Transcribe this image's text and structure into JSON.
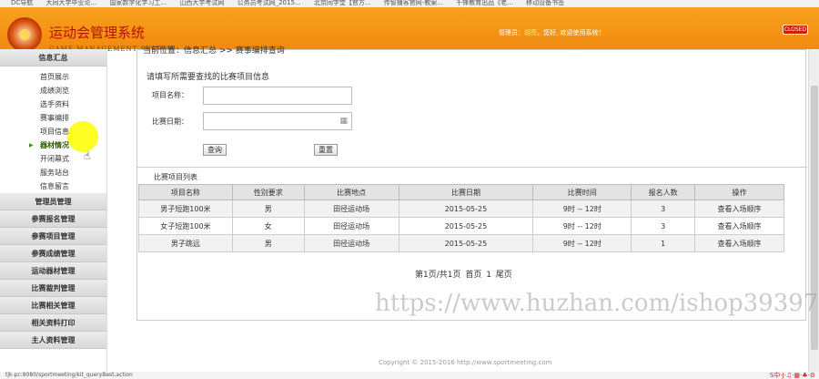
{
  "browser": {
    "bookmarks": [
      "DC导航",
      "大同大学毕业论...",
      "国家数字化学习工...",
      "山西大学考试网",
      "公务员考试网_2015...",
      "北京同学堂【官方...",
      "传智播客官网-教案...",
      "千锋教育出品《老...",
      "移动设备书签"
    ],
    "status_url": "tjk-pc:8080/sportmeeting/kit_queryBest.action"
  },
  "header": {
    "title": "运动会管理系统",
    "subtitle": "GAME MANAGEMENT SYSTEM",
    "welcome_prefix": "管理员：",
    "user_name": "胡亮",
    "welcome_suffix": "，您好, 欢迎使用系统！",
    "close_label": "CLOSED"
  },
  "sidebar": {
    "group_main": "信息汇总",
    "items": [
      "首页展示",
      "成绩浏览",
      "选手资料",
      "赛事编排",
      "项目信息",
      "器材情况",
      "开闭幕式",
      "服务站台",
      "信息留言"
    ],
    "active_index": 5,
    "groups": [
      "管理员管理",
      "参赛报名管理",
      "参赛项目管理",
      "参赛成绩管理",
      "运动器材管理",
      "比赛裁判管理",
      "比赛相关管理",
      "相关资料打印",
      "主人资料管理"
    ]
  },
  "main": {
    "breadcrumb": "当前位置：信息汇总 >> 赛事编排查询",
    "hint": "请填写所需要查找的比赛项目信息",
    "project_label": "项目名称：",
    "date_label": "比赛日期：",
    "project_value": "",
    "date_value": "",
    "search_button": "查询",
    "reset_button": "重置",
    "list_title": "比赛项目列表",
    "columns": [
      "项目名称",
      "性别要求",
      "比赛地点",
      "比赛日期",
      "比赛时间",
      "报名人数",
      "操作"
    ],
    "rows": [
      [
        "男子短跑100米",
        "男",
        "田径运动场",
        "2015-05-25",
        "9时 -- 12时",
        "3",
        "查看入场顺序"
      ],
      [
        "女子短跑100米",
        "女",
        "田径运动场",
        "2015-05-25",
        "9时 -- 12时",
        "3",
        "查看入场顺序"
      ],
      [
        "男子跳远",
        "男",
        "田径运动场",
        "2015-05-25",
        "9时 -- 12时",
        "1",
        "查看入场顺序"
      ]
    ],
    "pager": "第1页/共1页  首页  1  尾页"
  },
  "watermark": "https://www.huzhan.com/ishop39397",
  "footer": {
    "copyright": "Copyright © 2015-2016 http://www.sportmeeting.com"
  },
  "tray": "S中·J·♫·▦·♣·⚙"
}
